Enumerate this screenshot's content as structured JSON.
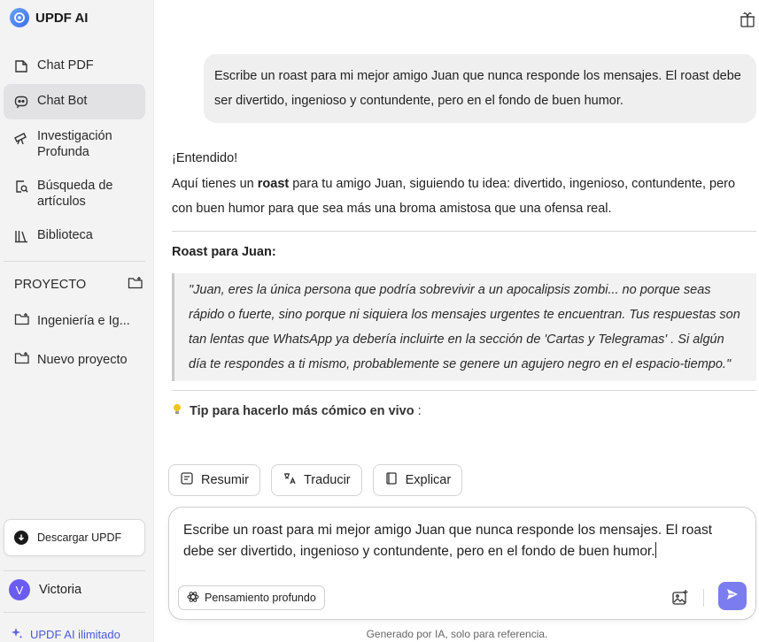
{
  "app": {
    "title": "UPDF AI"
  },
  "sidebar": {
    "items": [
      {
        "label": "Chat PDF",
        "icon": "chat-pdf-icon"
      },
      {
        "label": "Chat Bot",
        "icon": "chat-bot-icon",
        "active": true
      },
      {
        "label": "Investigación Profunda",
        "icon": "telescope-icon"
      },
      {
        "label": "Búsqueda de artículos",
        "icon": "article-search-icon"
      },
      {
        "label": "Biblioteca",
        "icon": "library-icon"
      }
    ],
    "project_header": "PROYECTO",
    "projects": [
      {
        "label": "Ingeniería e Ig..."
      },
      {
        "label": "Nuevo proyecto"
      }
    ],
    "download_label": "Descargar UPDF",
    "user": {
      "initial": "V",
      "name": "Victoria"
    },
    "upgrade_label": "UPDF AI ilimitado"
  },
  "chat": {
    "user_message": "Escribe un roast para mi mejor amigo Juan que nunca responde los mensajes. El roast debe ser divertido, ingenioso y contundente, pero en el fondo de buen humor.",
    "answer": {
      "intro": "¡Entendido!",
      "line_pre": "Aquí tienes un ",
      "line_bold": "roast",
      "line_post": " para tu amigo Juan, siguiendo tu idea: divertido, ingenioso, contundente, pero con buen humor para que sea más una broma amistosa que una ofensa real.",
      "roast_title": "Roast para Juan:",
      "quote": "\"Juan, eres la única persona que podría sobrevivir a un apocalipsis zombi... no porque seas rápido o fuerte, sino porque ni siquiera los mensajes urgentes te encuentran. Tus respuestas son tan lentas que WhatsApp ya debería incluirte en la sección de   'Cartas y Telegramas'  . Si algún día te respondes a ti mismo, probablemente se genere un agujero negro en el espacio-tiempo.\"",
      "tip_bold": "Tip para hacerlo más cómico en vivo",
      "tip_tail": " :"
    }
  },
  "actions": {
    "summarize": "Resumir",
    "translate": "Traducir",
    "explain": "Explicar"
  },
  "composer": {
    "value": "Escribe un roast para mi mejor amigo Juan que nunca responde los mensajes. El roast debe ser divertido, ingenioso y contundente, pero en el fondo de buen humor.",
    "deep_thinking_label": "Pensamiento profundo"
  },
  "footer": {
    "note": "Generado por IA, solo para referencia."
  },
  "colors": {
    "accent": "#7b7cf0",
    "link": "#4b5bd8",
    "avatar": "#6a5cf0"
  }
}
